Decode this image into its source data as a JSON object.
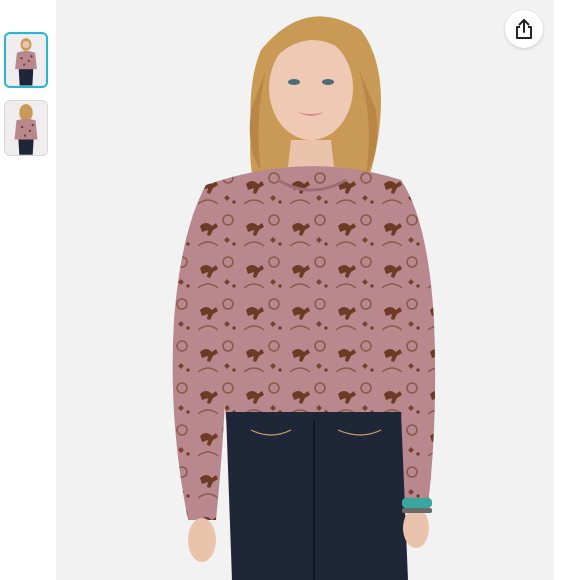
{
  "gallery": {
    "thumbnails": [
      {
        "label": "front-view",
        "selected": true
      },
      {
        "label": "back-view",
        "selected": false
      }
    ],
    "selected_index": 0
  },
  "product_image": {
    "subject": "model-wearing-printed-long-sleeve-top",
    "colors": {
      "background": "#f3f2f2",
      "top": "#b9888f",
      "print": "#6d3a24",
      "jeans": "#1f2638",
      "hair": "#c99a55"
    }
  },
  "toolbar": {
    "share_icon": "share-icon"
  },
  "colors": {
    "accent": "#2bb3d6"
  }
}
